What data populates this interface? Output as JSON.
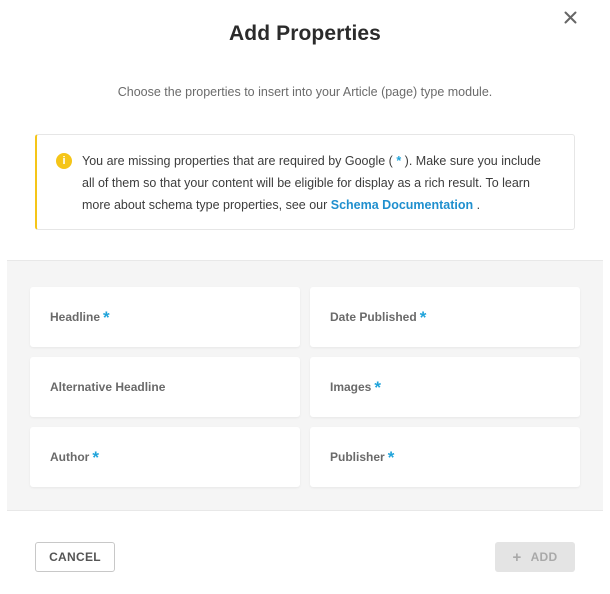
{
  "modal": {
    "title": "Add Properties",
    "subtitle": "Choose the properties to insert into your Article (page) type module.",
    "close_icon": "close-icon"
  },
  "notice": {
    "icon": "info-icon",
    "icon_glyph": "i",
    "text_part1": "You are missing properties that are required by Google (",
    "star": "*",
    "text_part2": "). Make sure you include all of them so that your content will be eligible for display as a rich result. To learn more about schema type properties, see our ",
    "link_text": "Schema Documentation",
    "text_part3": ".",
    "accent_color": "#f5c518"
  },
  "properties": [
    {
      "label": "Headline",
      "required": true
    },
    {
      "label": "Date Published",
      "required": true
    },
    {
      "label": "Alternative Headline",
      "required": false
    },
    {
      "label": "Images",
      "required": true
    },
    {
      "label": "Author",
      "required": true
    },
    {
      "label": "Publisher",
      "required": true
    }
  ],
  "required_marker": "*",
  "footer": {
    "cancel_label": "CANCEL",
    "add_label": "ADD",
    "add_icon": "plus-icon"
  },
  "colors": {
    "required": "#1fa3da",
    "link": "#1f8fce"
  }
}
